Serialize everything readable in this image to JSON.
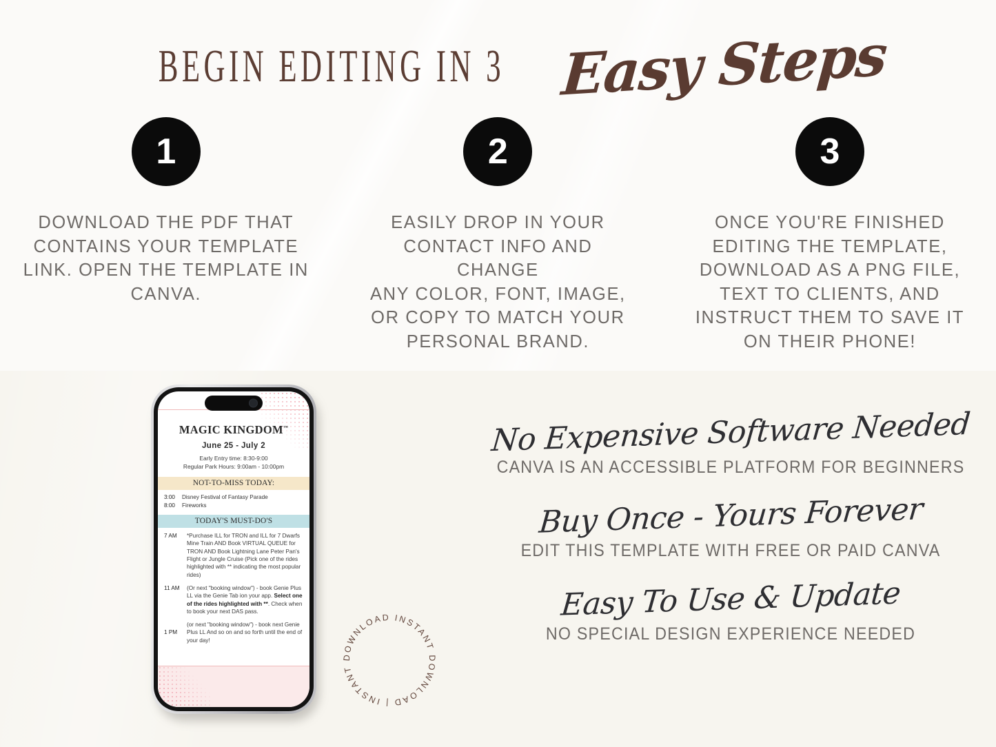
{
  "header": {
    "main": "BEGIN EDITING IN 3",
    "script": "Easy Steps"
  },
  "steps": [
    {
      "number": "1",
      "text": "DOWNLOAD THE PDF THAT\nCONTAINS YOUR TEMPLATE\nLINK. OPEN THE TEMPLATE IN\nCANVA."
    },
    {
      "number": "2",
      "text": "EASILY DROP IN YOUR\nCONTACT INFO AND CHANGE\nANY COLOR, FONT, IMAGE,\nOR COPY TO MATCH YOUR\nPERSONAL BRAND."
    },
    {
      "number": "3",
      "text": "ONCE YOU'RE FINISHED\nEDITING THE TEMPLATE,\nDOWNLOAD AS A PNG FILE,\nTEXT TO CLIENTS, AND\nINSTRUCT THEM TO SAVE IT\nON THEIR PHONE!"
    }
  ],
  "phone": {
    "park_title": "MAGIC KINGDOM",
    "trademark": "™",
    "dates": "June 25 - July 2",
    "early_entry": "Early Entry time: 8:30-9:00",
    "park_hours": "Regular Park Hours: 9:00am - 10:00pm",
    "band_not_to_miss": "NOT-TO-MISS TODAY:",
    "schedule": [
      {
        "time": "3:00",
        "desc": "Disney Festival of Fantasy Parade"
      },
      {
        "time": "8:00",
        "desc": "Fireworks"
      }
    ],
    "band_must_dos": "TODAY'S MUST-DO'S",
    "todos": [
      {
        "time": "7 AM",
        "text": "*Purchase ILL for TRON and ILL for 7 Dwarfs Mine Train AND Book VIRTUAL QUEUE for TRON AND Book Lightning Lane Peter Pan's Flight or Jungle Cruise (Pick one of the rides highlighted with ** indicating the most popular rides)"
      },
      {
        "time": "11 AM",
        "text_before": "(Or next \"booking window\") - book Genie Plus LL via the Genie Tab ion your app. ",
        "text_bold": "Select one of the rides highlighted with **",
        "text_after": ". Check when to book your next DAS pass."
      },
      {
        "time": "1 PM",
        "text": "(or next \"booking window\") - book next Genie Plus LL And so on and so forth until the end of your day!"
      }
    ]
  },
  "stamp": {
    "text": "INSTANT DOWNLOAD | INSTANT DOWNLOAD | "
  },
  "benefits": [
    {
      "script": "No Expensive Software Needed",
      "sub": "CANVA IS AN ACCESSIBLE PLATFORM FOR BEGINNERS"
    },
    {
      "script": "Buy Once - Yours Forever",
      "sub": "EDIT THIS TEMPLATE WITH FREE OR PAID CANVA"
    },
    {
      "script": "Easy To Use & Update",
      "sub": "NO SPECIAL DESIGN EXPERIENCE NEEDED"
    }
  ],
  "colors": {
    "title_brown": "#5b3d33",
    "body_grey": "#6e6a67",
    "circle_black": "#0b0b0b",
    "band_cream": "#f6e7c9",
    "band_blue": "#bfe0e5",
    "accent_pink": "#f0b9b9",
    "top_bg": "#fbfaf8",
    "bottom_bg": "#f7f5ef"
  }
}
